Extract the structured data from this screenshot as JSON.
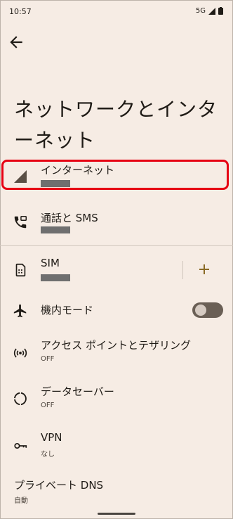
{
  "status_bar": {
    "time": "10:57",
    "network": "5G"
  },
  "page": {
    "title": "ネットワークとインターネット"
  },
  "items": [
    {
      "title": "インターネット",
      "subtitle": ""
    },
    {
      "title": "通話と SMS",
      "subtitle": ""
    },
    {
      "title": "SIM",
      "subtitle": ""
    },
    {
      "title": "機内モード",
      "subtitle": ""
    },
    {
      "title": "アクセス ポイントとテザリング",
      "subtitle": "OFF"
    },
    {
      "title": "データセーバー",
      "subtitle": "OFF"
    },
    {
      "title": "VPN",
      "subtitle": "なし"
    },
    {
      "title": "プライベート DNS",
      "subtitle": "自動"
    }
  ],
  "colors": {
    "background": "#f6ece4",
    "highlight": "#e60012",
    "accent": "#8a6a25"
  },
  "airplane_mode_on": false
}
